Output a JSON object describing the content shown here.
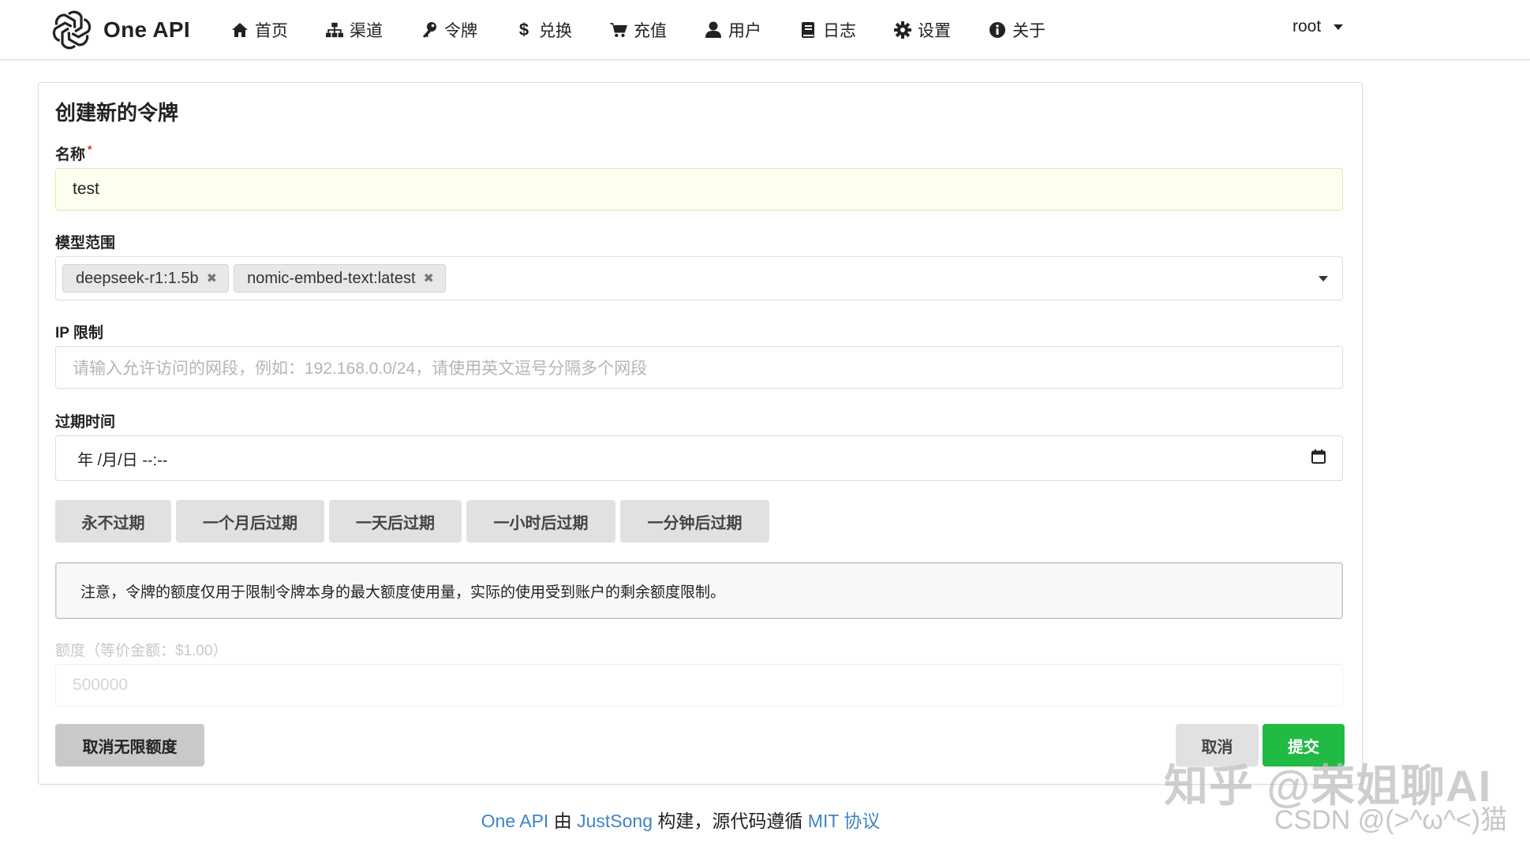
{
  "header": {
    "app_name": "One API",
    "menu": [
      {
        "icon": "home-icon",
        "label": "首页"
      },
      {
        "icon": "sitemap-icon",
        "label": "渠道"
      },
      {
        "icon": "key-icon",
        "label": "令牌"
      },
      {
        "icon": "dollar-icon",
        "label": "兑换"
      },
      {
        "icon": "cart-icon",
        "label": "充值"
      },
      {
        "icon": "user-icon",
        "label": "用户"
      },
      {
        "icon": "book-icon",
        "label": "日志"
      },
      {
        "icon": "gear-icon",
        "label": "设置"
      },
      {
        "icon": "info-icon",
        "label": "关于"
      }
    ],
    "user": "root"
  },
  "form": {
    "title": "创建新的令牌",
    "name_label": "名称",
    "name_value": "test",
    "models_label": "模型范围",
    "models": [
      "deepseek-r1:1.5b",
      "nomic-embed-text:latest"
    ],
    "ip_label": "IP 限制",
    "ip_placeholder": "请输入允许访问的网段，例如：192.168.0.0/24，请使用英文逗号分隔多个网段",
    "expire_label": "过期时间",
    "expire_value": "年 /月/日 --:--",
    "expire_buttons": [
      "永不过期",
      "一个月后过期",
      "一天后过期",
      "一小时后过期",
      "一分钟后过期"
    ],
    "notice": "注意，令牌的额度仅用于限制令牌本身的最大额度使用量，实际的使用受到账户的剩余额度限制。",
    "quota_label": "额度（等价金额：$1.00）",
    "quota_value": "500000",
    "unlimited_button": "取消无限额度",
    "cancel_button": "取消",
    "submit_button": "提交"
  },
  "footer": {
    "app": "One API",
    "by": " 由 ",
    "author": "JustSong",
    "built": " 构建，源代码遵循 ",
    "license": "MIT 协议"
  },
  "watermark": {
    "line1": "知乎 @荣姐聊AI",
    "line2": "CSDN @(>^ω^<)猫"
  },
  "colors": {
    "accent_submit": "#21ba45",
    "link": "#4183c4",
    "required": "#db2828"
  }
}
